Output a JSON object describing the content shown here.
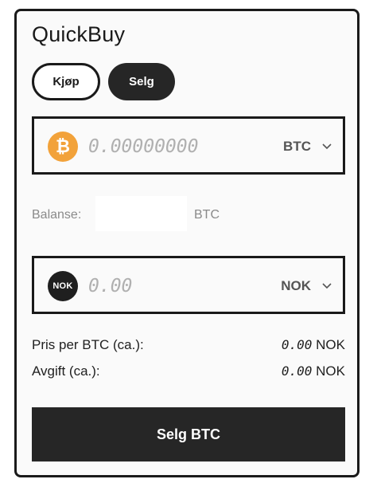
{
  "app": {
    "title": "QuickBuy"
  },
  "tabs": {
    "buy_label": "Kjøp",
    "sell_label": "Selg",
    "active": "sell"
  },
  "crypto_field": {
    "icon": "bitcoin-icon",
    "icon_glyph": "₿",
    "placeholder": "0.00000000",
    "value": "",
    "currency": "BTC",
    "brand_color": "#f2a23a"
  },
  "balance": {
    "label": "Balanse:",
    "value": "",
    "unit": "BTC"
  },
  "fiat_field": {
    "icon": "nok-icon",
    "icon_text": "NOK",
    "placeholder": "0.00",
    "value": "",
    "currency": "NOK"
  },
  "summary": {
    "price": {
      "label": "Pris per BTC (ca.):",
      "amount": "0.00",
      "unit": "NOK"
    },
    "fee": {
      "label": "Avgift (ca.):",
      "amount": "0.00",
      "unit": "NOK"
    }
  },
  "submit": {
    "label": "Selg BTC"
  },
  "colors": {
    "dark": "#262626",
    "border": "#1a1a1a",
    "muted_text": "#8a8a8a",
    "placeholder_text": "#b0b0b0"
  }
}
